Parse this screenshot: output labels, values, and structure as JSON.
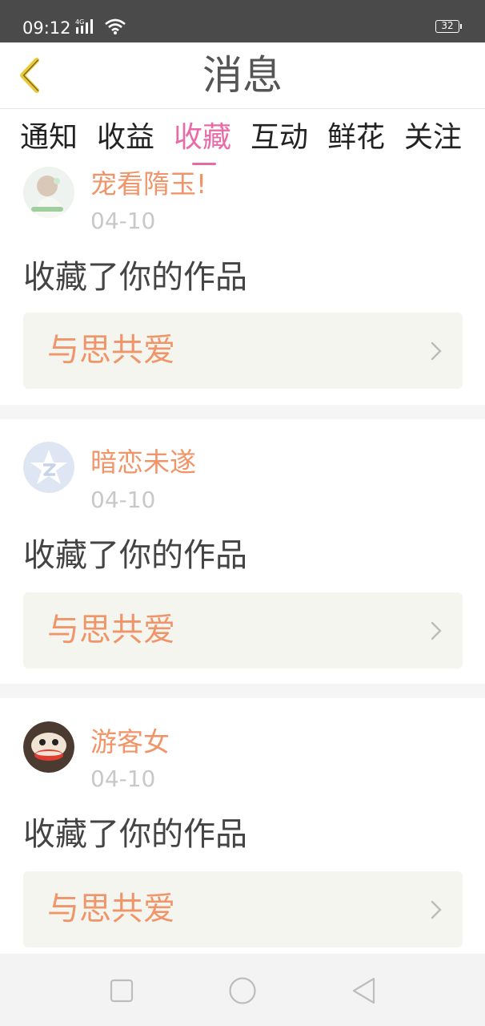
{
  "status_bar": {
    "time": "09:12",
    "network_label": "4G",
    "battery": "32",
    "icons": [
      "signal-icon",
      "wifi-icon",
      "battery-icon"
    ]
  },
  "header": {
    "title": "消息",
    "back_icon": "chevron-left-icon",
    "back_color": "#e9c93a"
  },
  "tabs": [
    {
      "label": "通知"
    },
    {
      "label": "收益"
    },
    {
      "label": "收藏",
      "active": true
    },
    {
      "label": "互动"
    },
    {
      "label": "鲜花"
    },
    {
      "label": "关注"
    }
  ],
  "colors": {
    "accent_pink": "#e86aa6",
    "name_orange": "#f0956a",
    "date_gray": "#c8c8c8",
    "link_bg": "#f5f5ef"
  },
  "items": [
    {
      "user": "宠看隋玉!",
      "date": "04-10",
      "action": "收藏了你的作品",
      "work_title": "与思共爱",
      "avatar_icon": "photo-avatar"
    },
    {
      "user": "暗恋未遂",
      "date": "04-10",
      "action": "收藏了你的作品",
      "work_title": "与思共爱",
      "avatar_icon": "qzone-star-avatar"
    },
    {
      "user": "游客女",
      "date": "04-10",
      "action": "收藏了你的作品",
      "work_title": "与思共爱",
      "avatar_icon": "monkey-avatar"
    }
  ],
  "nav_bar": {
    "icons": [
      "recent-apps-icon",
      "home-icon",
      "back-triangle-icon"
    ]
  }
}
